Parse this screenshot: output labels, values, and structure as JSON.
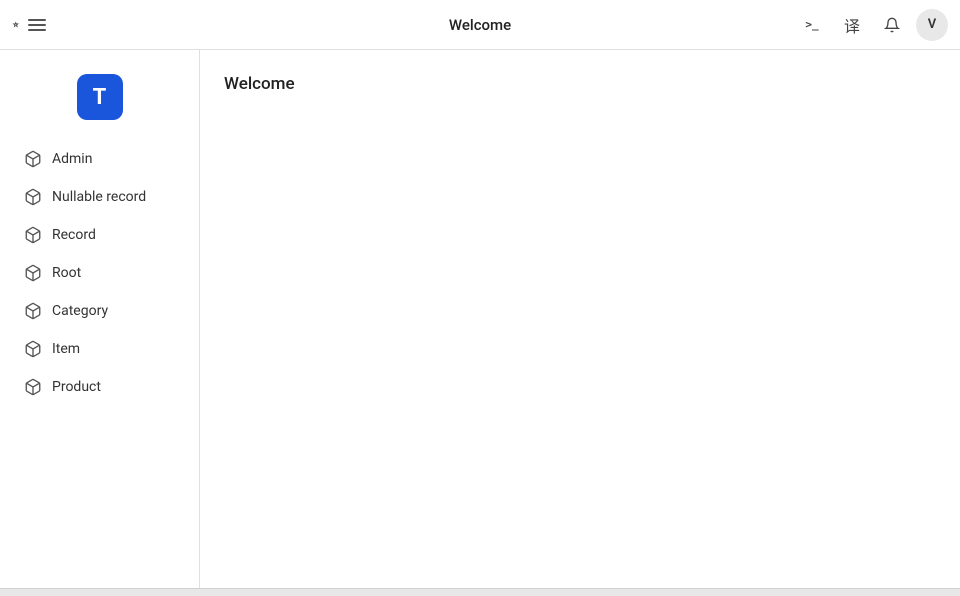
{
  "header": {
    "title": "Welcome",
    "left": {
      "cursor_label": "cursor",
      "menu_label": "menu"
    },
    "actions": {
      "terminal_label": ">_",
      "translate_label": "译",
      "bell_label": "🔔",
      "avatar_label": "V"
    }
  },
  "sidebar": {
    "logo_letter": "T",
    "items": [
      {
        "id": "admin",
        "label": "Admin"
      },
      {
        "id": "nullable-record",
        "label": "Nullable record"
      },
      {
        "id": "record",
        "label": "Record"
      },
      {
        "id": "root",
        "label": "Root"
      },
      {
        "id": "category",
        "label": "Category"
      },
      {
        "id": "item",
        "label": "Item"
      },
      {
        "id": "product",
        "label": "Product"
      }
    ]
  },
  "content": {
    "title": "Welcome"
  }
}
